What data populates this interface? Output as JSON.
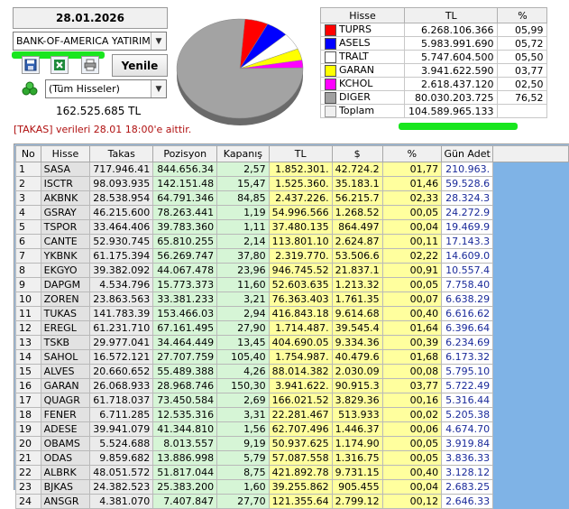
{
  "header": {
    "date": "28.01.2026",
    "broker": "BANK-OF-AMERICA YATIRIM",
    "refresh": "Yenile",
    "filter": "(Tüm Hisseler)",
    "total": "162.525.685 TL",
    "note": "[TAKAS] verileri 28.01 18:00'e aittir."
  },
  "colors": {
    "green_mark": "#19e61e",
    "pos_bg": "#d6f5d6",
    "tl_bg": "#ffff9e",
    "gun_text": "#1a2a9a"
  },
  "icons": {
    "save": "save-icon",
    "excel": "excel-icon",
    "print": "print-icon",
    "group": "group-icon"
  },
  "summary": {
    "headers": [
      "Hisse",
      "TL",
      "%"
    ],
    "rows": [
      {
        "name": "TUPRS",
        "tl": "6.268.106.366",
        "pct": "05,99",
        "color": "#ff0000"
      },
      {
        "name": "ASELS",
        "tl": "5.983.991.690",
        "pct": "05,72",
        "color": "#0000ff"
      },
      {
        "name": "TRALT",
        "tl": "5.747.604.500",
        "pct": "05,50",
        "color": "#ffffff"
      },
      {
        "name": "GARAN",
        "tl": "3.941.622.590",
        "pct": "03,77",
        "color": "#ffff00"
      },
      {
        "name": "KCHOL",
        "tl": "2.618.437.120",
        "pct": "02,50",
        "color": "#ff00ff"
      },
      {
        "name": "DIGER",
        "tl": "80.030.203.725",
        "pct": "76,52",
        "color": "#a0a0a0"
      }
    ],
    "total_label": "Toplam",
    "total_value": "104.589.965.133"
  },
  "grid": {
    "headers": [
      "No",
      "Hisse",
      "Takas",
      "Pozisyon",
      "Kapanış",
      "TL",
      "$",
      "%",
      "Gün Adet"
    ],
    "rows": [
      [
        "1",
        "SASA",
        "717.946.41",
        "844.656.34",
        "2,57",
        "1.852.301.",
        "42.724.2",
        "01,77",
        "210.963."
      ],
      [
        "2",
        "ISCTR",
        "98.093.935",
        "142.151.48",
        "15,47",
        "1.525.360.",
        "35.183.1",
        "01,46",
        "59.528.6"
      ],
      [
        "3",
        "AKBNK",
        "28.538.954",
        "64.791.346",
        "84,85",
        "2.437.226.",
        "56.215.7",
        "02,33",
        "28.324.3"
      ],
      [
        "4",
        "GSRAY",
        "46.215.600",
        "78.263.441",
        "1,19",
        "54.996.566",
        "1.268.52",
        "00,05",
        "24.272.9"
      ],
      [
        "5",
        "TSPOR",
        "33.464.406",
        "39.783.360",
        "1,11",
        "37.480.135",
        "864.497",
        "00,04",
        "19.469.9"
      ],
      [
        "6",
        "CANTE",
        "52.930.745",
        "65.810.255",
        "2,14",
        "113.801.10",
        "2.624.87",
        "00,11",
        "17.143.3"
      ],
      [
        "7",
        "YKBNK",
        "61.175.394",
        "56.269.747",
        "37,80",
        "2.319.770.",
        "53.506.6",
        "02,22",
        "14.609.0"
      ],
      [
        "8",
        "EKGYO",
        "39.382.092",
        "44.067.478",
        "23,96",
        "946.745.52",
        "21.837.1",
        "00,91",
        "10.557.4"
      ],
      [
        "9",
        "DAPGM",
        "4.534.796",
        "15.773.373",
        "11,60",
        "52.603.635",
        "1.213.32",
        "00,05",
        "7.758.40"
      ],
      [
        "10",
        "ZOREN",
        "23.863.563",
        "33.381.233",
        "3,21",
        "76.363.403",
        "1.761.35",
        "00,07",
        "6.638.29"
      ],
      [
        "11",
        "TUKAS",
        "141.783.39",
        "153.466.03",
        "2,94",
        "416.843.18",
        "9.614.68",
        "00,40",
        "6.616.62"
      ],
      [
        "12",
        "EREGL",
        "61.231.710",
        "67.161.495",
        "27,90",
        "1.714.487.",
        "39.545.4",
        "01,64",
        "6.396.64"
      ],
      [
        "13",
        "TSKB",
        "29.977.041",
        "34.464.449",
        "13,45",
        "404.690.05",
        "9.334.36",
        "00,39",
        "6.234.69"
      ],
      [
        "14",
        "SAHOL",
        "16.572.121",
        "27.707.759",
        "105,40",
        "1.754.987.",
        "40.479.6",
        "01,68",
        "6.173.32"
      ],
      [
        "15",
        "ALVES",
        "20.660.652",
        "55.489.388",
        "4,26",
        "88.014.382",
        "2.030.09",
        "00,08",
        "5.795.10"
      ],
      [
        "16",
        "GARAN",
        "26.068.933",
        "28.968.746",
        "150,30",
        "3.941.622.",
        "90.915.3",
        "03,77",
        "5.722.49"
      ],
      [
        "17",
        "QUAGR",
        "61.718.037",
        "73.450.584",
        "2,69",
        "166.021.52",
        "3.829.36",
        "00,16",
        "5.316.44"
      ],
      [
        "18",
        "FENER",
        "6.711.285",
        "12.535.316",
        "3,31",
        "22.281.467",
        "513.933",
        "00,02",
        "5.205.38"
      ],
      [
        "19",
        "ADESE",
        "39.941.079",
        "41.344.810",
        "1,56",
        "62.707.496",
        "1.446.37",
        "00,06",
        "4.674.70"
      ],
      [
        "20",
        "OBAMS",
        "5.524.688",
        "8.013.557",
        "9,19",
        "50.937.625",
        "1.174.90",
        "00,05",
        "3.919.84"
      ],
      [
        "21",
        "ODAS",
        "9.859.682",
        "13.886.998",
        "5,79",
        "57.087.558",
        "1.316.75",
        "00,05",
        "3.836.33"
      ],
      [
        "22",
        "ALBRK",
        "48.051.572",
        "51.817.044",
        "8,75",
        "421.892.78",
        "9.731.15",
        "00,40",
        "3.128.12"
      ],
      [
        "23",
        "BJKAS",
        "24.382.523",
        "25.383.200",
        "1,60",
        "39.255.862",
        "905.455",
        "00,04",
        "2.683.25"
      ],
      [
        "24",
        "ANSGR",
        "4.381.070",
        "7.407.847",
        "27,70",
        "121.355.64",
        "2.799.12",
        "00,12",
        "2.646.33"
      ]
    ]
  }
}
